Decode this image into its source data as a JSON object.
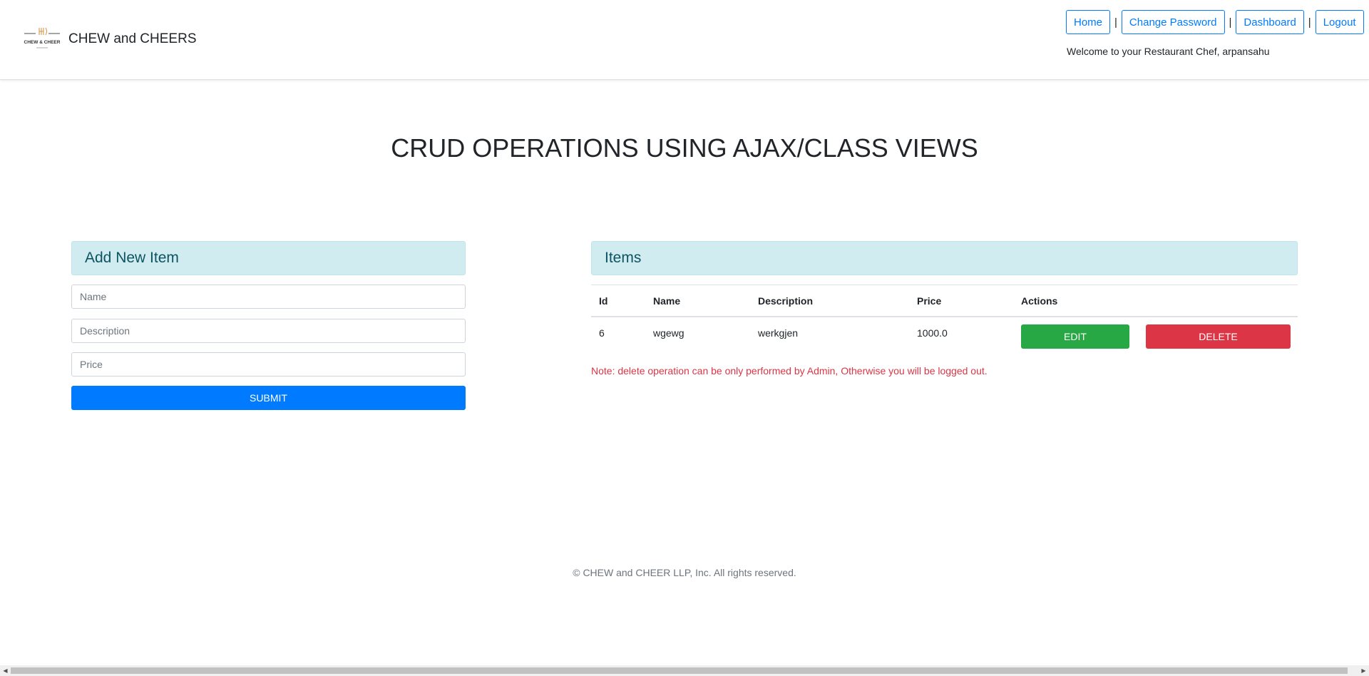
{
  "header": {
    "logo_alt": "CHEW & CHEER logo",
    "brand": "CHEW and CHEERS",
    "nav": [
      "Home",
      "Change Password",
      "Dashboard",
      "Logout"
    ],
    "separator": "|",
    "welcome": "Welcome to your Restaurant Chef, arpansahu"
  },
  "page": {
    "title": "CRUD OPERATIONS USING AJAX/CLASS VIEWS"
  },
  "form": {
    "title": "Add New Item",
    "name_placeholder": "Name",
    "description_placeholder": "Description",
    "price_placeholder": "Price",
    "submit_label": "SUBMIT"
  },
  "items": {
    "title": "Items",
    "columns": [
      "Id",
      "Name",
      "Description",
      "Price",
      "Actions"
    ],
    "rows": [
      {
        "id": "6",
        "name": "wgewg",
        "description": "werkgjen",
        "price": "1000.0",
        "edit_label": "EDIT",
        "delete_label": "DELETE"
      }
    ],
    "note": "Note: delete operation can be only performed by Admin, Otherwise you will be logged out."
  },
  "footer": {
    "text": "© CHEW and CHEER LLP, Inc. All rights reserved."
  },
  "colors": {
    "primary": "#007bff",
    "success": "#28a745",
    "danger": "#dc3545",
    "info_bg": "#d1ecf1",
    "info_text": "#0c5460"
  }
}
